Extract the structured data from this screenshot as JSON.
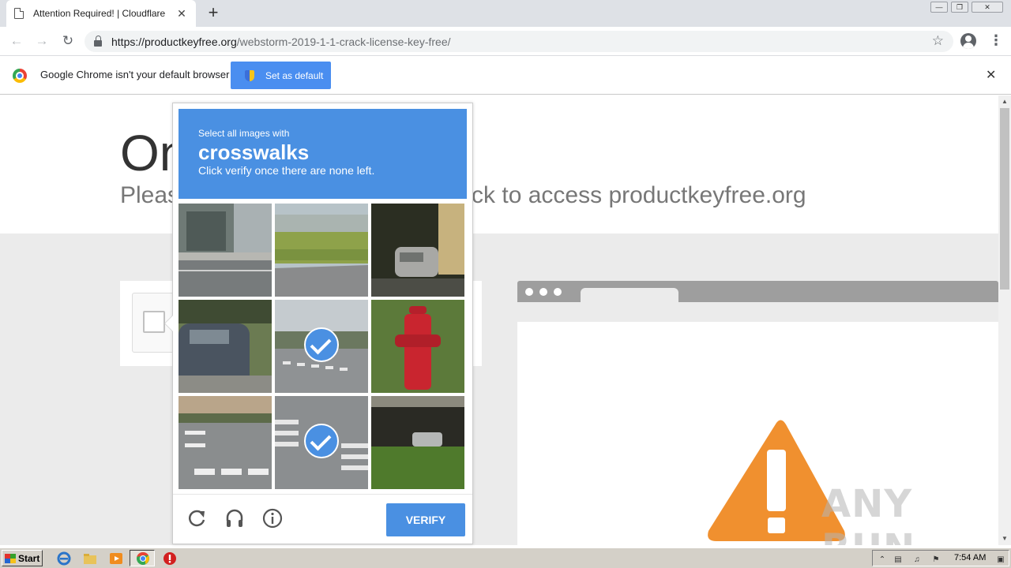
{
  "browser": {
    "tab_title": "Attention Required! | Cloudflare",
    "tab_close": "✕",
    "new_tab": "+",
    "url_host": "https://productkeyfree.org",
    "url_path": "/webstorm-2019-1-1-crack-license-key-free/",
    "window_buttons": [
      "—",
      "❐",
      "✕"
    ]
  },
  "infobar": {
    "message": "Google Chrome isn't your default browser",
    "button_label": "Set as default",
    "close": "✕"
  },
  "page": {
    "headline": "On",
    "subline_left": "Pleas",
    "subline_right": "ck to access productkeyfree.org",
    "watermark": "ANY RUN"
  },
  "captcha": {
    "instruction_small": "Select all images with",
    "target": "crosswalks",
    "instruction_sub": "Click verify once there are none left.",
    "verify_label": "VERIFY",
    "tiles_selected": [
      false,
      false,
      false,
      false,
      true,
      false,
      false,
      true,
      false
    ]
  },
  "taskbar": {
    "start_label": "Start",
    "clock": "7:54 AM"
  },
  "colors": {
    "captcha_blue": "#4a90e2",
    "chrome_button_blue": "#4a8ef0",
    "warning_orange": "#f0902f"
  }
}
